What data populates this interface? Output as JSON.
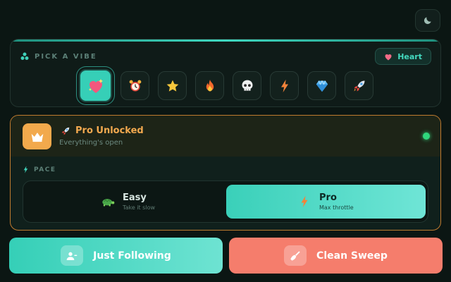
{
  "theme_toggle": {
    "icon": "moon-icon"
  },
  "vibe": {
    "title": "PICK A VIBE",
    "selected_label": "Heart",
    "options": [
      {
        "icon": "heart-sparkle-icon",
        "selected": true
      },
      {
        "icon": "alarm-clock-icon",
        "selected": false
      },
      {
        "icon": "star-icon",
        "selected": false
      },
      {
        "icon": "fire-icon",
        "selected": false
      },
      {
        "icon": "skull-icon",
        "selected": false
      },
      {
        "icon": "lightning-icon",
        "selected": false
      },
      {
        "icon": "gem-icon",
        "selected": false
      },
      {
        "icon": "rocket-icon",
        "selected": false
      }
    ]
  },
  "pro": {
    "title": "Pro Unlocked",
    "subtitle": "Everything's open",
    "status": "active"
  },
  "pace": {
    "title": "PACE",
    "options": [
      {
        "label": "Easy",
        "desc": "Take it slow",
        "icon": "turtle-icon",
        "selected": false
      },
      {
        "label": "Pro",
        "desc": "Max throttle",
        "icon": "lightning-icon",
        "selected": true
      }
    ]
  },
  "actions": {
    "follow_label": "Just Following",
    "sweep_label": "Clean Sweep"
  },
  "colors": {
    "accent": "#3ad0b9",
    "warning": "#f3a94f",
    "danger": "#f57d6c",
    "background": "#0b1613"
  }
}
